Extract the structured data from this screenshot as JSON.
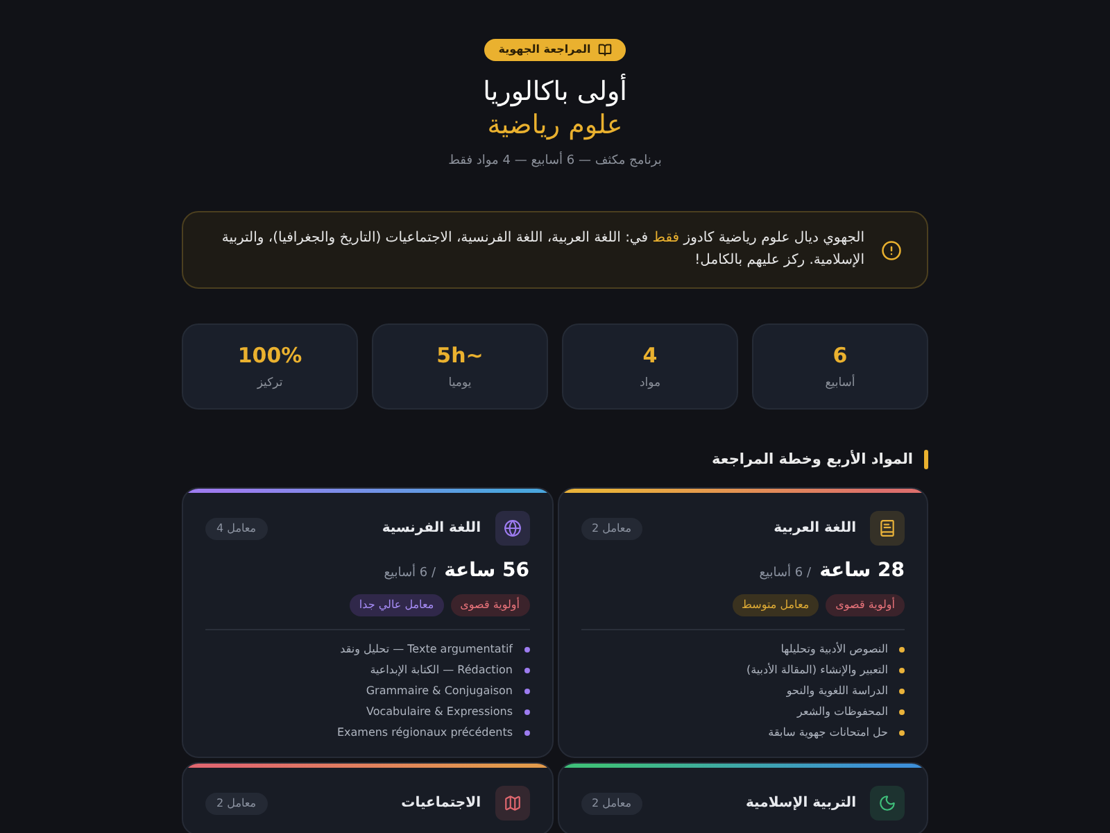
{
  "badge": {
    "label": "المراجعة الجهوية"
  },
  "title": {
    "line_1": "أولى باكالوريا",
    "line_2": "علوم رياضية"
  },
  "subtitle": "برنامج مكثف — 6 أسابيع — 4 مواد فقط",
  "notice": {
    "text": "الجهوي ديال علوم رياضية كادوز **فقط** في: اللغة العربية، اللغة الفرنسية، الاجتماعيات (التاريخ والجغرافيا)، والتربية الإسلامية. ركز عليهم بالكامل!"
  },
  "stats": [
    {
      "value": "6",
      "label": "أسابيع"
    },
    {
      "value": "4",
      "label": "مواد"
    },
    {
      "value": "~5h",
      "label": "يوميا"
    },
    {
      "value": "100%",
      "label": "تركيز"
    }
  ],
  "section_title": "المواد الأربع وخطة المراجعة",
  "subjects": [
    {
      "name": "اللغة العربية",
      "coefficient": "معامل 2",
      "color": "#e9b23a",
      "bar_end": {
        "color": "#dc6f6c"
      },
      "hours": "28 ساعة",
      "duration": "/ 6 أسابيع",
      "tags": [
        {
          "label": "أولوية قصوى",
          "kind": "priority"
        },
        {
          "label": "معامل متوسط",
          "kind": "medium"
        }
      ],
      "topics": [
        "النصوص الأدبية وتحليلها",
        "التعبير والإنشاء (المقالة الأدبية)",
        "الدراسة اللغوية والنحو",
        "المحفوظات والشعر",
        "حل امتحانات جهوية سابقة"
      ]
    },
    {
      "name": "اللغة الفرنسية",
      "coefficient": "معامل 4",
      "color": "#9d7cf0",
      "bar_end": {
        "color": "#4aa6de"
      },
      "hours": "56 ساعة",
      "duration": "/ 6 أسابيع",
      "tags": [
        {
          "label": "أولوية قصوى",
          "kind": "priority"
        },
        {
          "label": "معامل عالي جدا",
          "kind": "high"
        }
      ],
      "topics": [
        "Texte argumentatif — تحليل ونقد",
        "Rédaction — الكتابة الإبداعية",
        "Grammaire & Conjugaison",
        "Vocabulaire & Expressions",
        "Examens régionaux précédents"
      ]
    },
    {
      "name": "التربية الإسلامية",
      "coefficient": "معامل 2",
      "color": "#3fbf7a",
      "bar_end": {
        "color": "#3d8fd8"
      }
    },
    {
      "name": "الاجتماعيات",
      "coefficient": "معامل 2",
      "color": "#e0676f",
      "bar_end": {
        "color": "#e29a4c"
      }
    }
  ]
}
